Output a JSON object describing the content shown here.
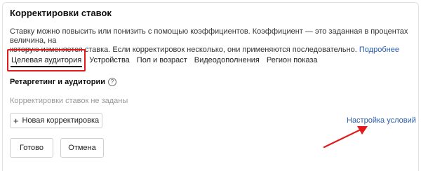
{
  "header": {
    "title": "Корректировки ставок",
    "description_line1": "Ставку можно повысить или понизить с помощью коэффициентов. Коэффициент — это заданная в процентах величина, на",
    "description_line2": "которую изменяется ставка. Если корректировок несколько, они применяются последовательно.",
    "more_link": "Подробнее"
  },
  "tabs": [
    {
      "label": "Целевая аудитория",
      "active": true
    },
    {
      "label": "Устройства",
      "active": false
    },
    {
      "label": "Пол и возраст",
      "active": false
    },
    {
      "label": "Видеодополнения",
      "active": false
    },
    {
      "label": "Регион показа",
      "active": false
    }
  ],
  "section": {
    "title": "Ретаргетинг и аудитории",
    "help_icon": "?",
    "empty_text": "Корректировки ставок не заданы",
    "add_button": "Новая корректировка",
    "add_icon": "+",
    "settings_link": "Настройка условий"
  },
  "footer": {
    "ready_button": "Готово",
    "cancel_button": "Отмена"
  },
  "colors": {
    "highlight": "#e3191b",
    "link": "#2a5db0"
  }
}
